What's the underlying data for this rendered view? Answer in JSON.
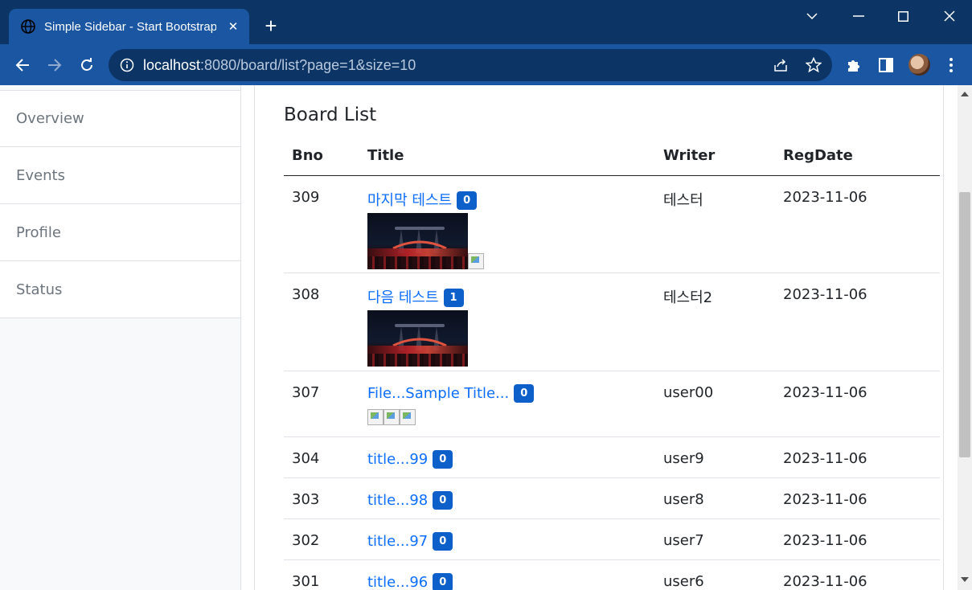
{
  "browser": {
    "tab_title": "Simple Sidebar - Start Bootstrap Template",
    "new_tab_label": "+",
    "close_tab_label": "✕",
    "url_host": "localhost",
    "url_path": ":8080/board/list?page=1&size=10",
    "icons": {
      "tab": "globe-icon",
      "back": "back-arrow-icon",
      "forward": "forward-arrow-icon",
      "reload": "reload-icon",
      "site_info": "info-icon",
      "share": "share-icon",
      "bookmark": "star-icon",
      "extensions": "puzzle-icon",
      "side_panel": "side-panel-icon",
      "menu": "kebab-menu-icon"
    },
    "colors": {
      "tab_strip": "#0c3566",
      "toolbar": "#1a56a2"
    }
  },
  "sidebar": {
    "items": [
      {
        "label": "Overview"
      },
      {
        "label": "Events"
      },
      {
        "label": "Profile"
      },
      {
        "label": "Status"
      }
    ]
  },
  "board": {
    "title": "Board List",
    "headers": {
      "bno": "Bno",
      "title": "Title",
      "writer": "Writer",
      "regdate": "RegDate"
    },
    "rows": [
      {
        "bno": "309",
        "title": "마지막 테스트",
        "replies": "0",
        "writer": "테스터",
        "regdate": "2023-11-06"
      },
      {
        "bno": "308",
        "title": "다음 테스트",
        "replies": "1",
        "writer": "테스터2",
        "regdate": "2023-11-06"
      },
      {
        "bno": "307",
        "title": "File...Sample Title...",
        "replies": "0",
        "writer": "user00",
        "regdate": "2023-11-06"
      },
      {
        "bno": "304",
        "title": "title...99",
        "replies": "0",
        "writer": "user9",
        "regdate": "2023-11-06"
      },
      {
        "bno": "303",
        "title": "title...98",
        "replies": "0",
        "writer": "user8",
        "regdate": "2023-11-06"
      },
      {
        "bno": "302",
        "title": "title...97",
        "replies": "0",
        "writer": "user7",
        "regdate": "2023-11-06"
      },
      {
        "bno": "301",
        "title": "title...96",
        "replies": "0",
        "writer": "user6",
        "regdate": "2023-11-06"
      }
    ],
    "colors": {
      "link": "#0d6efd",
      "badge": "#0d5fc9"
    }
  }
}
